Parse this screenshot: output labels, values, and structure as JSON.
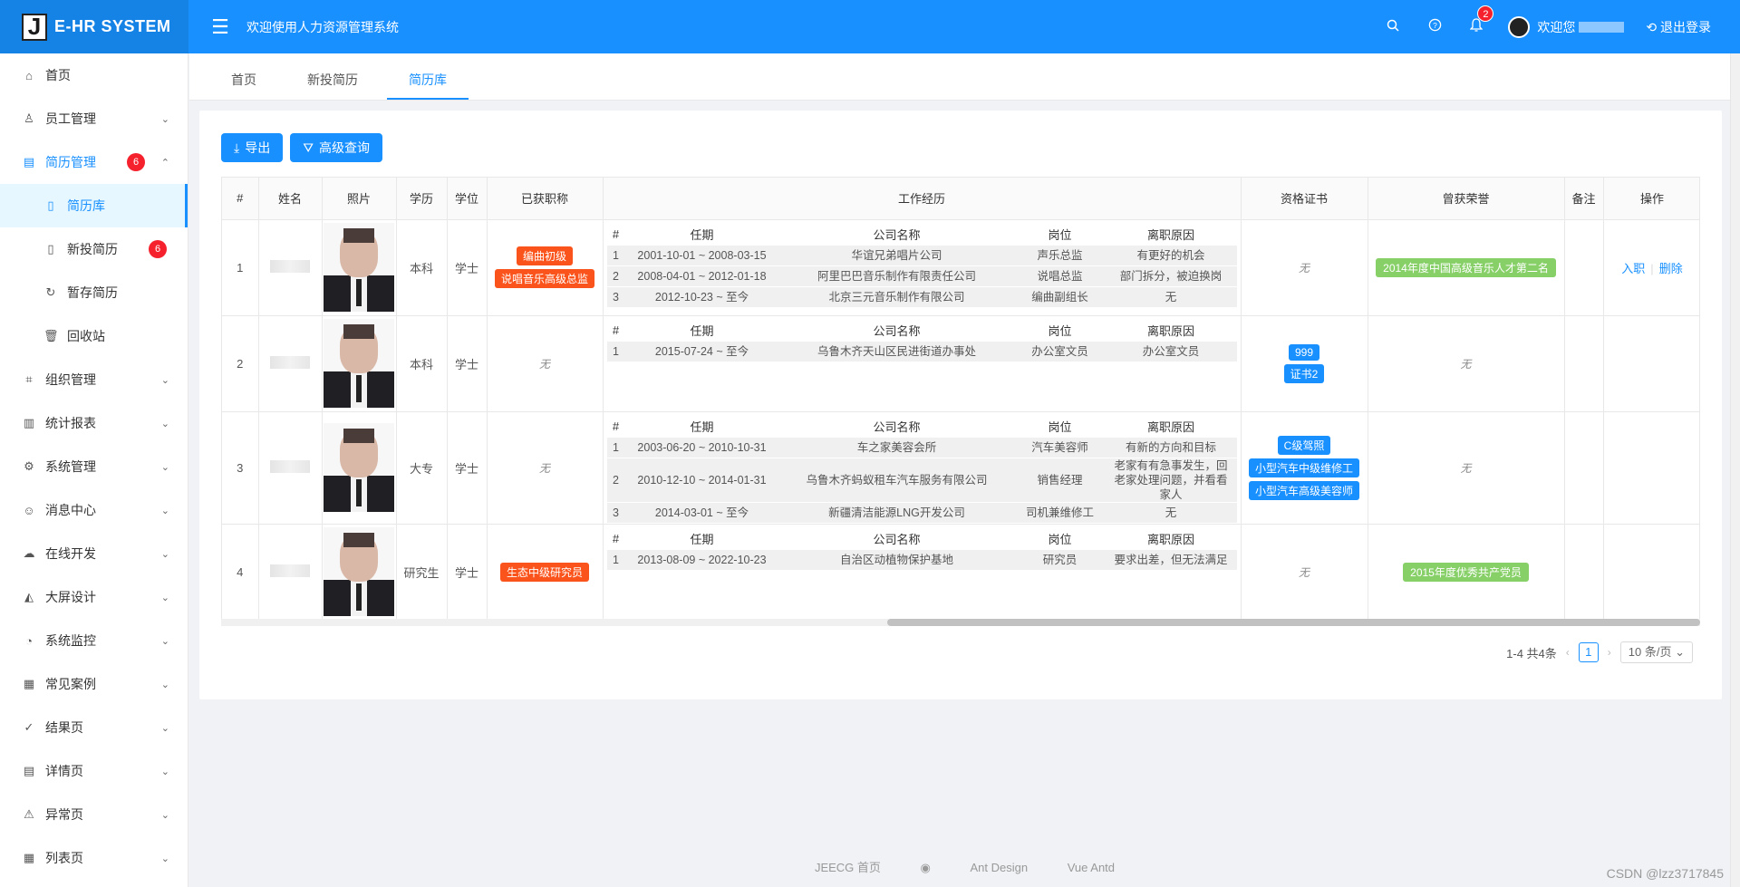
{
  "header": {
    "logo_letter": "J",
    "app_name": "E-HR SYSTEM",
    "welcome_title": "欢迎使用人力资源管理系统",
    "notification_count": "2",
    "user_greeting": "欢迎您",
    "logout_label": "退出登录"
  },
  "sidebar": {
    "items": [
      {
        "label": "首页",
        "icon": "home-icon"
      },
      {
        "label": "员工管理",
        "icon": "user-icon"
      },
      {
        "label": "简历管理",
        "icon": "resume-icon",
        "badge": "6"
      },
      {
        "label": "简历库",
        "icon": "file-icon"
      },
      {
        "label": "新投简历",
        "icon": "file-icon",
        "badge": "6"
      },
      {
        "label": "暂存简历",
        "icon": "reload-icon"
      },
      {
        "label": "回收站",
        "icon": "trash-icon"
      },
      {
        "label": "组织管理",
        "icon": "org-icon"
      },
      {
        "label": "统计报表",
        "icon": "bar-chart-icon"
      },
      {
        "label": "系统管理",
        "icon": "settings-icon"
      },
      {
        "label": "消息中心",
        "icon": "message-icon"
      },
      {
        "label": "在线开发",
        "icon": "cloud-icon"
      },
      {
        "label": "大屏设计",
        "icon": "area-chart-icon"
      },
      {
        "label": "系统监控",
        "icon": "dashboard-icon"
      },
      {
        "label": "常见案例",
        "icon": "qrcode-icon"
      },
      {
        "label": "结果页",
        "icon": "check-circle-icon"
      },
      {
        "label": "详情页",
        "icon": "profile-icon"
      },
      {
        "label": "异常页",
        "icon": "warning-icon"
      },
      {
        "label": "列表页",
        "icon": "table-icon"
      }
    ]
  },
  "tabs": [
    "首页",
    "新投简历",
    "简历库"
  ],
  "toolbar": {
    "export_label": "导出",
    "advanced_query_label": "高级查询"
  },
  "table": {
    "columns": [
      "#",
      "姓名",
      "照片",
      "学历",
      "学位",
      "已获职称",
      "工作经历",
      "资格证书",
      "曾获荣誉",
      "备注",
      "操作"
    ],
    "sub_columns": [
      "#",
      "任期",
      "公司名称",
      "岗位",
      "离职原因"
    ],
    "none_text": "无",
    "action_hire": "入职",
    "action_delete": "删除",
    "rows": [
      {
        "index": "1",
        "education": "本科",
        "degree": "学士",
        "titles": [
          "编曲初级",
          "说唱音乐高级总监"
        ],
        "work": [
          {
            "no": "1",
            "period": "2001-10-01 ~ 2008-03-15",
            "company": "华谊兄弟唱片公司",
            "position": "声乐总监",
            "reason": "有更好的机会"
          },
          {
            "no": "2",
            "period": "2008-04-01 ~ 2012-01-18",
            "company": "阿里巴巴音乐制作有限责任公司",
            "position": "说唱总监",
            "reason": "部门拆分，被迫换岗"
          },
          {
            "no": "3",
            "period": "2012-10-23 ~ 至今",
            "company": "北京三元音乐制作有限公司",
            "position": "编曲副组长",
            "reason": "无"
          }
        ],
        "certificates": [],
        "honors": [
          "2014年度中国高级音乐人才第二名"
        ],
        "has_actions": true
      },
      {
        "index": "2",
        "education": "本科",
        "degree": "学士",
        "titles": [],
        "work": [
          {
            "no": "1",
            "period": "2015-07-24 ~ 至今",
            "company": "乌鲁木齐天山区民进街道办事处",
            "position": "办公室文员",
            "reason": "办公室文员"
          }
        ],
        "certificates": [
          "999",
          "证书2"
        ],
        "honors": [],
        "has_actions": false
      },
      {
        "index": "3",
        "education": "大专",
        "degree": "学士",
        "titles": [],
        "work": [
          {
            "no": "1",
            "period": "2003-06-20 ~ 2010-10-31",
            "company": "车之家美容会所",
            "position": "汽车美容师",
            "reason": "有新的方向和目标"
          },
          {
            "no": "2",
            "period": "2010-12-10 ~ 2014-01-31",
            "company": "乌鲁木齐蚂蚁租车汽车服务有限公司",
            "position": "销售经理",
            "reason": "老家有有急事发生，回老家处理问题，并看看家人"
          },
          {
            "no": "3",
            "period": "2014-03-01 ~ 至今",
            "company": "新疆清洁能源LNG开发公司",
            "position": "司机兼维修工",
            "reason": "无"
          }
        ],
        "certificates": [
          "C级驾照",
          "小型汽车中级维修工",
          "小型汽车高级美容师"
        ],
        "honors": [],
        "has_actions": false
      },
      {
        "index": "4",
        "education": "研究生",
        "degree": "学士",
        "titles": [
          "生态中级研究员"
        ],
        "work": [
          {
            "no": "1",
            "period": "2013-08-09 ~ 2022-10-23",
            "company": "自治区动植物保护基地",
            "position": "研究员",
            "reason": "要求出差，但无法满足"
          }
        ],
        "certificates": [],
        "honors": [
          "2015年度优秀共产党员"
        ],
        "has_actions": false
      }
    ]
  },
  "pagination": {
    "summary": "1-4 共4条",
    "current_page": "1",
    "page_size": "10 条/页"
  },
  "footer": {
    "links": [
      "JEECG 首页",
      "Ant Design",
      "Vue Antd"
    ]
  },
  "watermark": "CSDN @lzz3717845",
  "colors": {
    "primary": "#1890ff",
    "title_tag": "#fa541c",
    "honor_tag": "#87d068",
    "badge": "#f5222d"
  }
}
